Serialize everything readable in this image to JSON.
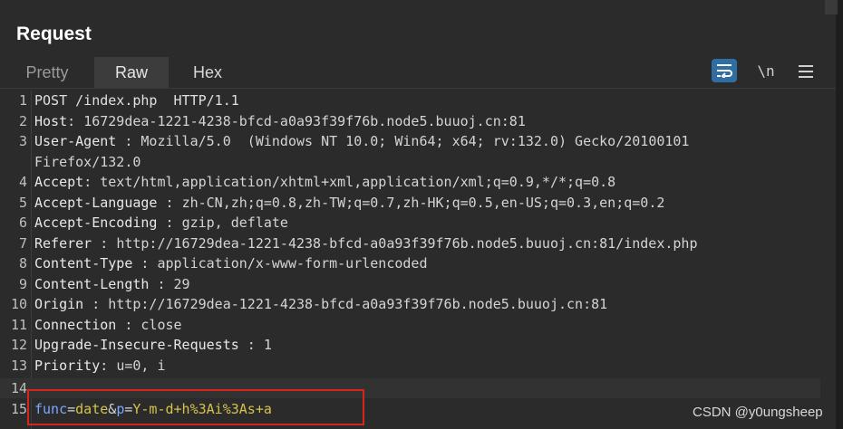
{
  "panel": {
    "title": "Request"
  },
  "tabs": [
    {
      "label": "Pretty"
    },
    {
      "label": "Raw"
    },
    {
      "label": "Hex"
    }
  ],
  "toolbar": {
    "wrap_icon": "wrap-lines-icon",
    "newline_label": "\\n",
    "menu_icon": "hamburger-menu-icon"
  },
  "lines": [
    {
      "n": "1",
      "request": "POST /index.php  HTTP/1.1"
    },
    {
      "n": "2",
      "key": "Host",
      "value": "16729dea-1221-4238-bfcd-a0a93f39f76b.node5.buuoj.cn:81"
    },
    {
      "n": "3",
      "key": "User-Agent",
      "value": "Mozilla/5.0  (Windows NT 10.0; Win64; x64; rv:132.0) Gecko/20100101"
    },
    {
      "n": "",
      "cont": "Firefox/132.0"
    },
    {
      "n": "4",
      "key": "Accept",
      "value": "text/html,application/xhtml+xml,application/xml;q=0.9,*/*;q=0.8"
    },
    {
      "n": "5",
      "key": "Accept-Language",
      "value": "zh-CN,zh;q=0.8,zh-TW;q=0.7,zh-HK;q=0.5,en-US;q=0.3,en;q=0.2"
    },
    {
      "n": "6",
      "key": "Accept-Encoding",
      "value": "gzip, deflate"
    },
    {
      "n": "7",
      "key": "Referer",
      "value": "http://16729dea-1221-4238-bfcd-a0a93f39f76b.node5.buuoj.cn:81/index.php"
    },
    {
      "n": "8",
      "key": "Content-Type",
      "value": "application/x-www-form-urlencoded"
    },
    {
      "n": "9",
      "key": "Content-Length",
      "value": "29"
    },
    {
      "n": "10",
      "key": "Origin",
      "value": "http://16729dea-1221-4238-bfcd-a0a93f39f76b.node5.buuoj.cn:81"
    },
    {
      "n": "11",
      "key": "Connection",
      "value": "close"
    },
    {
      "n": "12",
      "key": "Upgrade-Insecure-Requests",
      "value": "1"
    },
    {
      "n": "13",
      "key": "Priority",
      "value": "u=0, i"
    },
    {
      "n": "14"
    },
    {
      "n": "15",
      "body": {
        "p1": "func",
        "v1": "date",
        "p2": "p",
        "v2": "Y-m-d+h%3Ai%3As+a"
      }
    }
  ],
  "watermark": "CSDN @y0ungsheep",
  "colors": {
    "accent": "#2f6ea3",
    "highlight_box": "#d9231f",
    "param_name": "#7aa8ff",
    "param_value": "#d6c24c"
  }
}
